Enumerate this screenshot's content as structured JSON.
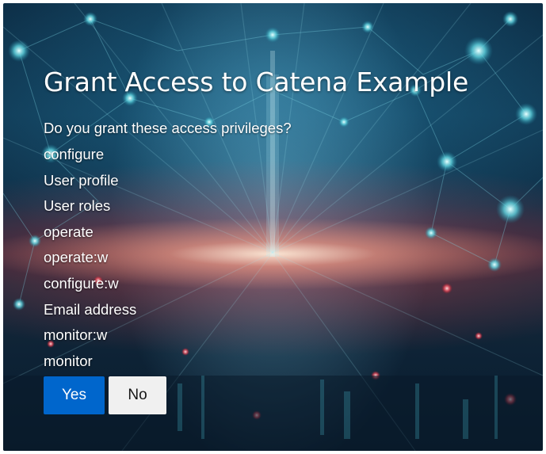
{
  "dialog": {
    "title": "Grant Access to Catena Example",
    "question": "Do you grant these access privileges?",
    "scopes": [
      "configure",
      "User profile",
      "User roles",
      "operate",
      "operate:w",
      "configure:w",
      "Email address",
      "monitor:w",
      "monitor"
    ],
    "yes_label": "Yes",
    "no_label": "No"
  },
  "colors": {
    "primary_button": "#0066cc",
    "secondary_button": "#f0f0f0",
    "text": "#ffffff"
  }
}
